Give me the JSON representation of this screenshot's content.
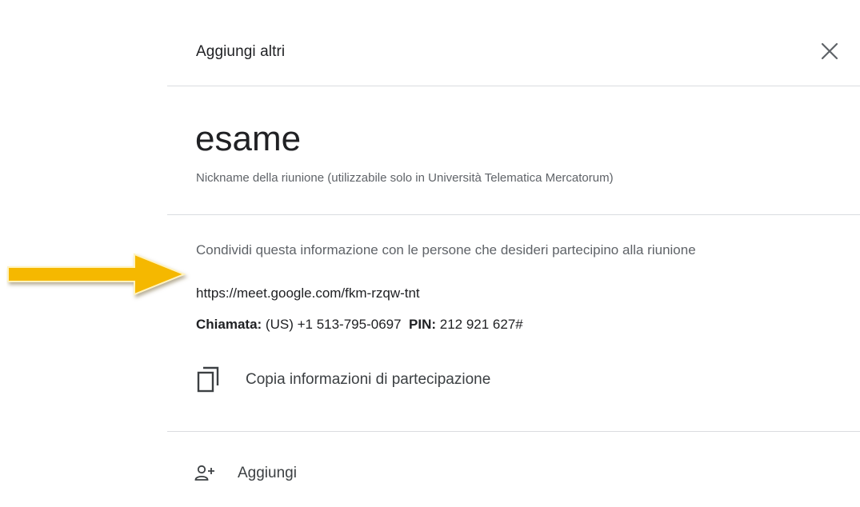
{
  "header": {
    "title": "Aggiungi altri",
    "close_icon": "close-icon"
  },
  "meeting": {
    "name": "esame",
    "hint": "Nickname della riunione (utilizzabile solo in Università Telematica Mercatorum)"
  },
  "share": {
    "intro": "Condividi questa informazione con le persone che desideri partecipino alla riunione",
    "link": "https://meet.google.com/fkm-rzqw-tnt",
    "phone_label": "Chiamata:",
    "phone_value": "(US) +1 513-795-0697",
    "pin_label": "PIN:",
    "pin_value": "212 921 627#"
  },
  "copy": {
    "icon": "copy-icon",
    "label": "Copia informazioni di partecipazione"
  },
  "add": {
    "icon": "person-add-icon",
    "label": "Aggiungi"
  },
  "annotation": {
    "icon": "arrow-right-icon",
    "color": "#f5b800"
  },
  "colors": {
    "text_primary": "#202124",
    "text_secondary": "#5f6368",
    "divider": "#dadce0",
    "arrow": "#f5b800"
  }
}
